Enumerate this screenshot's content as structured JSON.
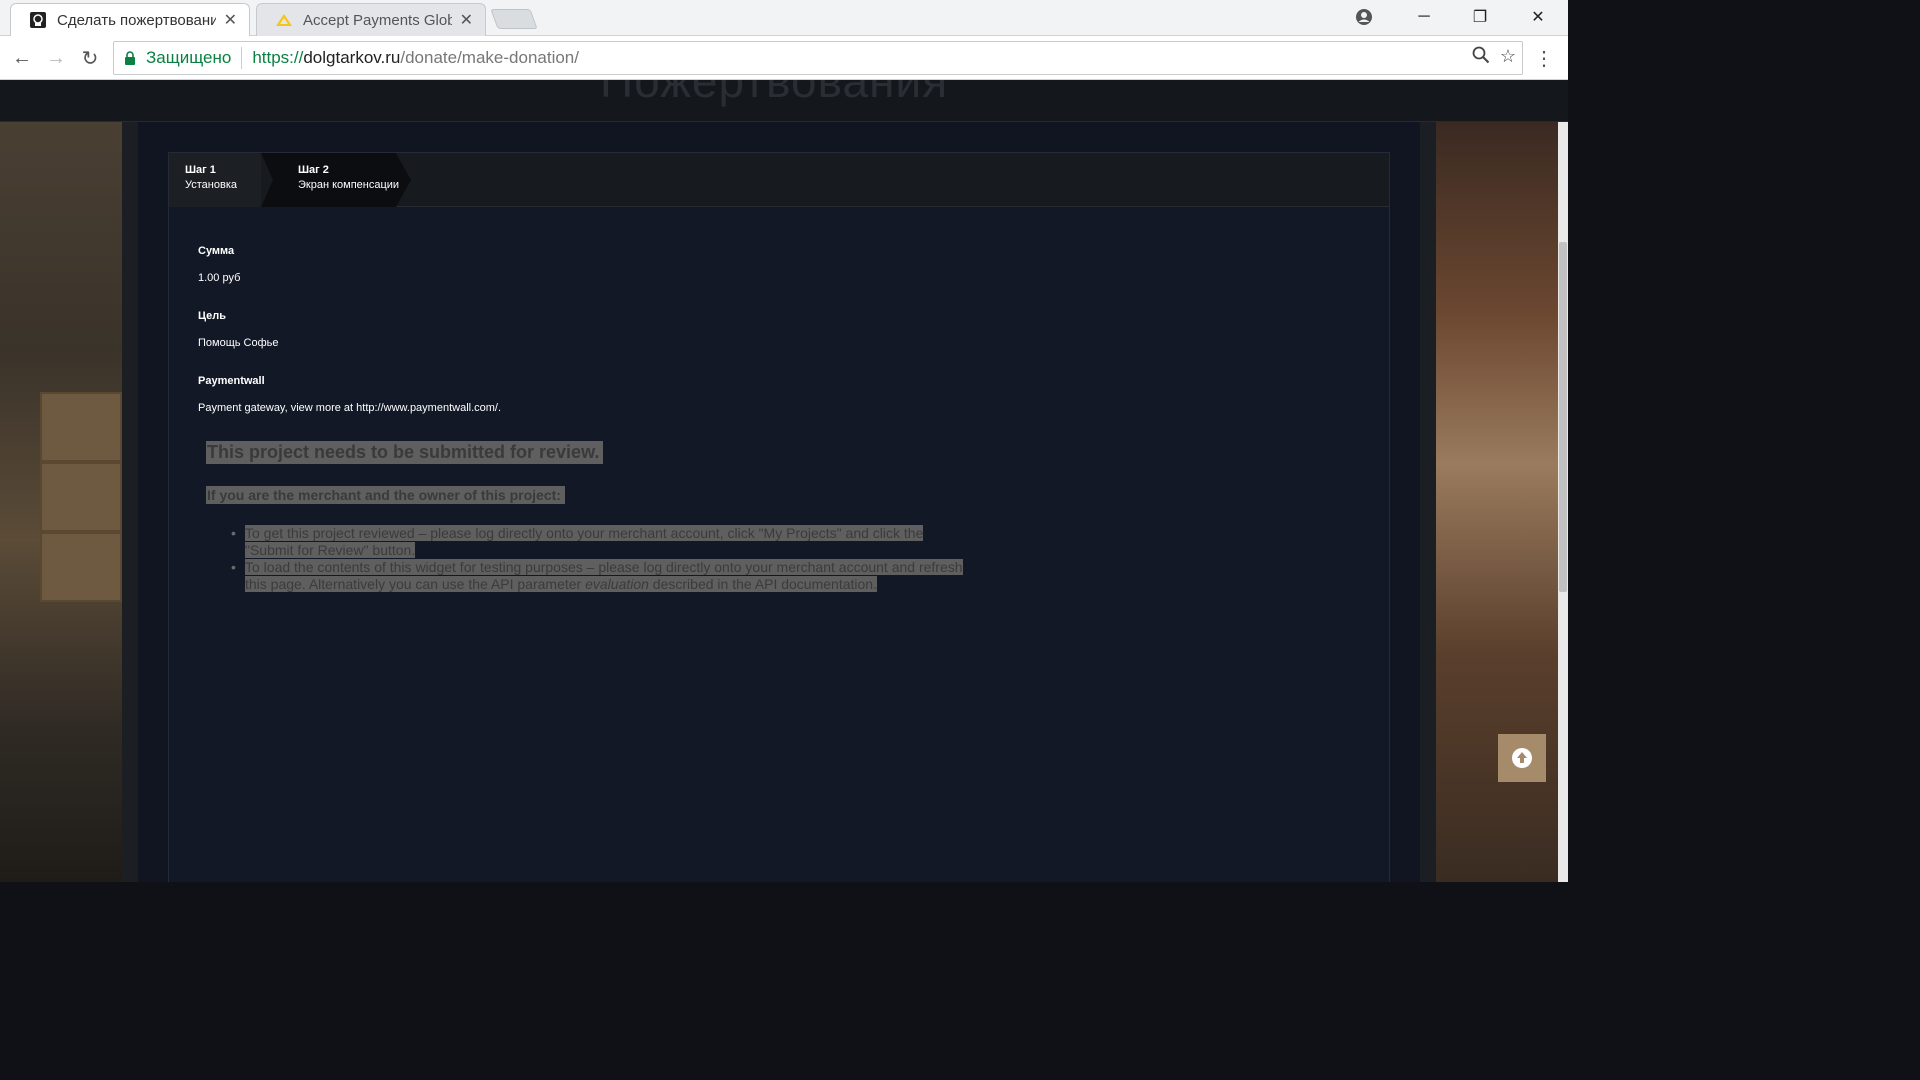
{
  "tabs": [
    {
      "title": "Сделать пожертвование",
      "active": true,
      "close": "✕"
    },
    {
      "title": "Accept Payments Globall",
      "active": false,
      "close": "✕"
    }
  ],
  "window_controls": {
    "account": "account-icon",
    "minimize": "─",
    "restore": "❐",
    "close": "✕"
  },
  "toolbar": {
    "back": "←",
    "forward": "→",
    "reload": "↻",
    "secure_label": "Защищено",
    "url_scheme": "https://",
    "url_host": "dolgtarkov.ru",
    "url_path": "/donate/make-donation/",
    "zoom_icon": "🔍",
    "bookmark_icon": "☆",
    "menu": "⋮"
  },
  "page": {
    "header_ghost": "Пожертвования",
    "steps": [
      {
        "num": "Шаг 1",
        "label": "Установка"
      },
      {
        "num": "Шаг 2",
        "label": "Экран компенсации"
      }
    ],
    "fields": [
      {
        "label": "Сумма",
        "value": "1.00 руб"
      },
      {
        "label": "Цель",
        "value": "Помощь Софье"
      },
      {
        "label": "Paymentwall",
        "value": "Payment gateway, view more at http://www.paymentwall.com/."
      }
    ],
    "widget": {
      "title": "This project needs to be submitted for review.",
      "subtitle": "If you are the merchant and the owner of this project:",
      "items": [
        "To get this project reviewed – please log directly onto your merchant account, click \"My Projects\" and click the \"Submit for Review\" button.",
        {
          "before": "To load the contents of this widget for testing purposes – please log directly onto your merchant account and refresh this page. Alternatively you can use the API parameter ",
          "em": "evaluation",
          "after": " described in the API documentation."
        }
      ]
    }
  },
  "colors": {
    "accent_secure": "#0b8043",
    "scroll_top_bg": "#a68b6a",
    "panel_bg": "#121826"
  }
}
